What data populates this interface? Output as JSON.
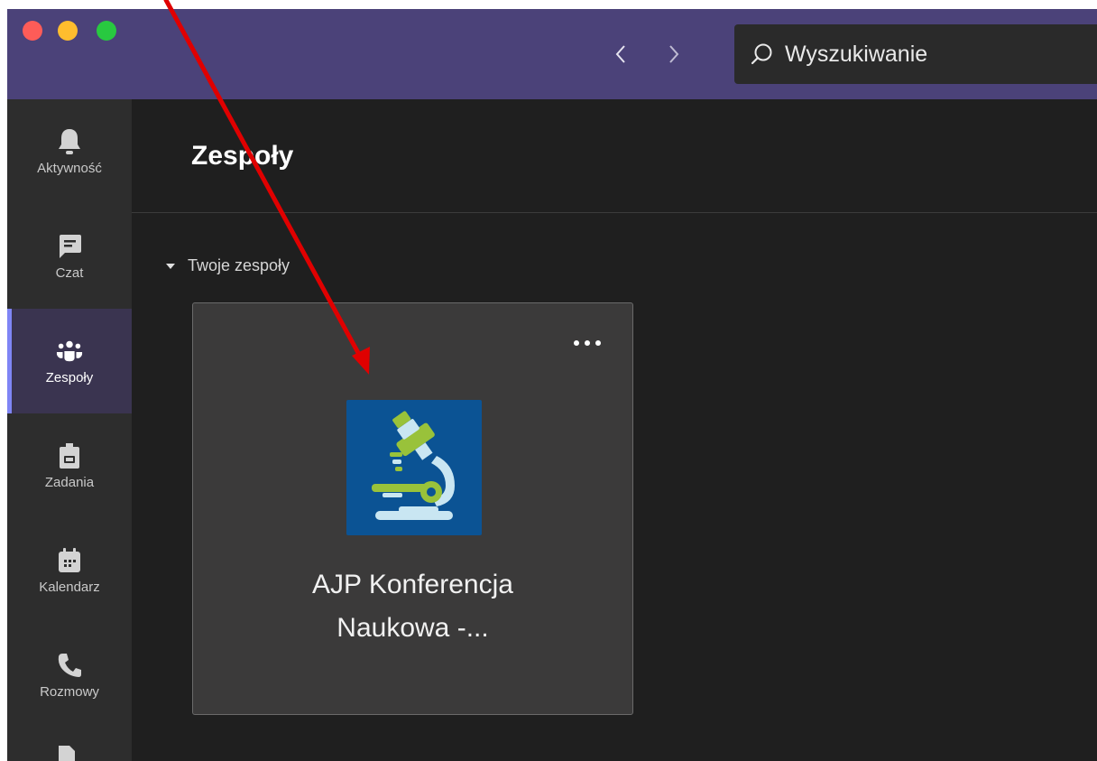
{
  "titlebar": {
    "search": {
      "placeholder": "Wyszukiwanie",
      "value": ""
    }
  },
  "rail": {
    "items": [
      {
        "label": "Aktywność",
        "icon": "bell-icon"
      },
      {
        "label": "Czat",
        "icon": "chat-icon"
      },
      {
        "label": "Zespoły",
        "icon": "teams-icon",
        "active": true
      },
      {
        "label": "Zadania",
        "icon": "assignments-icon"
      },
      {
        "label": "Kalendarz",
        "icon": "calendar-icon"
      },
      {
        "label": "Rozmowy",
        "icon": "phone-icon"
      }
    ]
  },
  "main": {
    "title": "Zespoły",
    "section_label": "Twoje zespoły",
    "teams": [
      {
        "name_line1": "AJP Konferencja",
        "name_line2": "Naukowa -...",
        "icon": "microscope-icon"
      }
    ]
  },
  "colors": {
    "titlebar": "#4b4279",
    "rail": "#2d2d2d",
    "background": "#1f1f1f",
    "card": "#3b3a3a",
    "accent": "#7f85f5",
    "annotation_arrow": "#e00000"
  }
}
